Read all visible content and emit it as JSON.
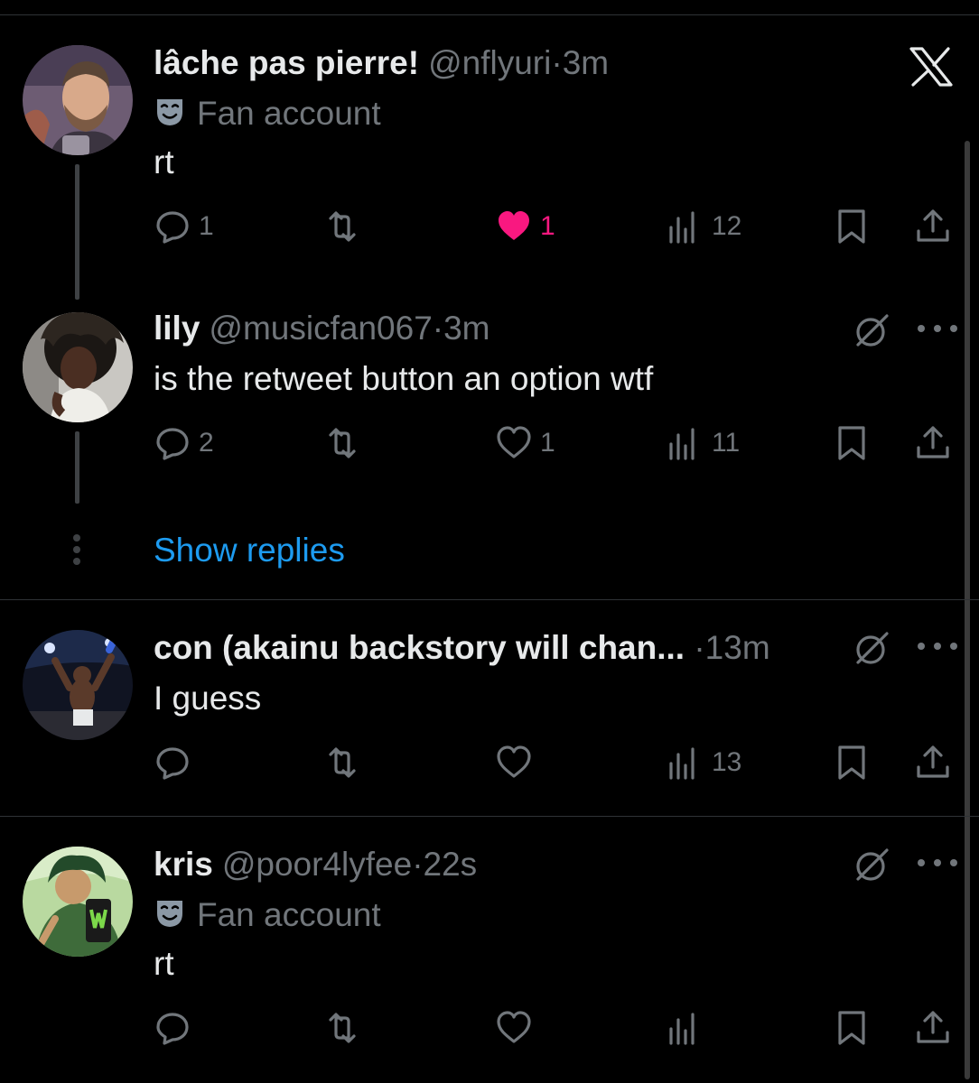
{
  "app": {
    "logo_icon": "x-logo-icon"
  },
  "colors": {
    "background": "#000000",
    "text": "#e7e9ea",
    "muted": "#71767b",
    "link": "#1d9bf0",
    "like": "#f91880"
  },
  "tweets": [
    {
      "name": "lâche pas pierre!",
      "handle": "@nflyuri",
      "time": "3m",
      "badge": "Fan account",
      "text": "rt",
      "actions": {
        "replies": "1",
        "reposts": "",
        "likes": "1",
        "views": "12",
        "liked": true
      }
    },
    {
      "name": "lily",
      "handle": "@musicfan067",
      "time": "3m",
      "text": "is the retweet button an option wtf",
      "actions": {
        "replies": "2",
        "reposts": "",
        "likes": "1",
        "views": "11",
        "liked": false
      }
    },
    {
      "name": "con (akainu backstory will chan...",
      "time": "13m",
      "text": "I guess",
      "actions": {
        "replies": "",
        "reposts": "",
        "likes": "",
        "views": "13",
        "liked": false
      }
    },
    {
      "name": "kris",
      "handle": "@poor4lyfee",
      "time": "22s",
      "badge": "Fan account",
      "text": "rt",
      "actions": {
        "replies": "",
        "reposts": "",
        "likes": "",
        "views": "",
        "liked": false
      }
    }
  ],
  "show_replies": "Show replies",
  "separator": "·"
}
